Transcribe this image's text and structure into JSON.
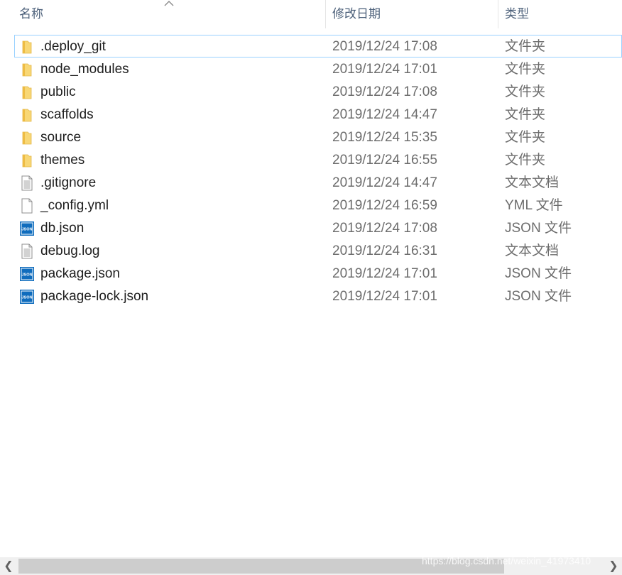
{
  "columns": {
    "name": "名称",
    "date": "修改日期",
    "type": "类型"
  },
  "files": [
    {
      "name": ".deploy_git",
      "date": "2019/12/24 17:08",
      "type": "文件夹",
      "icon": "folder-icon",
      "selected": true
    },
    {
      "name": "node_modules",
      "date": "2019/12/24 17:01",
      "type": "文件夹",
      "icon": "folder-icon"
    },
    {
      "name": "public",
      "date": "2019/12/24 17:08",
      "type": "文件夹",
      "icon": "folder-icon"
    },
    {
      "name": "scaffolds",
      "date": "2019/12/24 14:47",
      "type": "文件夹",
      "icon": "folder-icon"
    },
    {
      "name": "source",
      "date": "2019/12/24 15:35",
      "type": "文件夹",
      "icon": "folder-icon"
    },
    {
      "name": "themes",
      "date": "2019/12/24 16:55",
      "type": "文件夹",
      "icon": "folder-icon"
    },
    {
      "name": ".gitignore",
      "date": "2019/12/24 14:47",
      "type": "文本文档",
      "icon": "text-file-icon"
    },
    {
      "name": "_config.yml",
      "date": "2019/12/24 16:59",
      "type": "YML 文件",
      "icon": "blank-file-icon"
    },
    {
      "name": "db.json",
      "date": "2019/12/24 17:08",
      "type": "JSON 文件",
      "icon": "json-file-icon"
    },
    {
      "name": "debug.log",
      "date": "2019/12/24 16:31",
      "type": "文本文档",
      "icon": "text-file-icon"
    },
    {
      "name": "package.json",
      "date": "2019/12/24 17:01",
      "type": "JSON 文件",
      "icon": "json-file-icon"
    },
    {
      "name": "package-lock.json",
      "date": "2019/12/24 17:01",
      "type": "JSON 文件",
      "icon": "json-file-icon"
    }
  ],
  "json_icon_text": "JSON",
  "colors": {
    "selection_border": "#99d1ff",
    "folder": "#f8d775",
    "json_badge": "#0f6cbd"
  },
  "watermark": "https://blog.csdn.net/weixin_41973410"
}
